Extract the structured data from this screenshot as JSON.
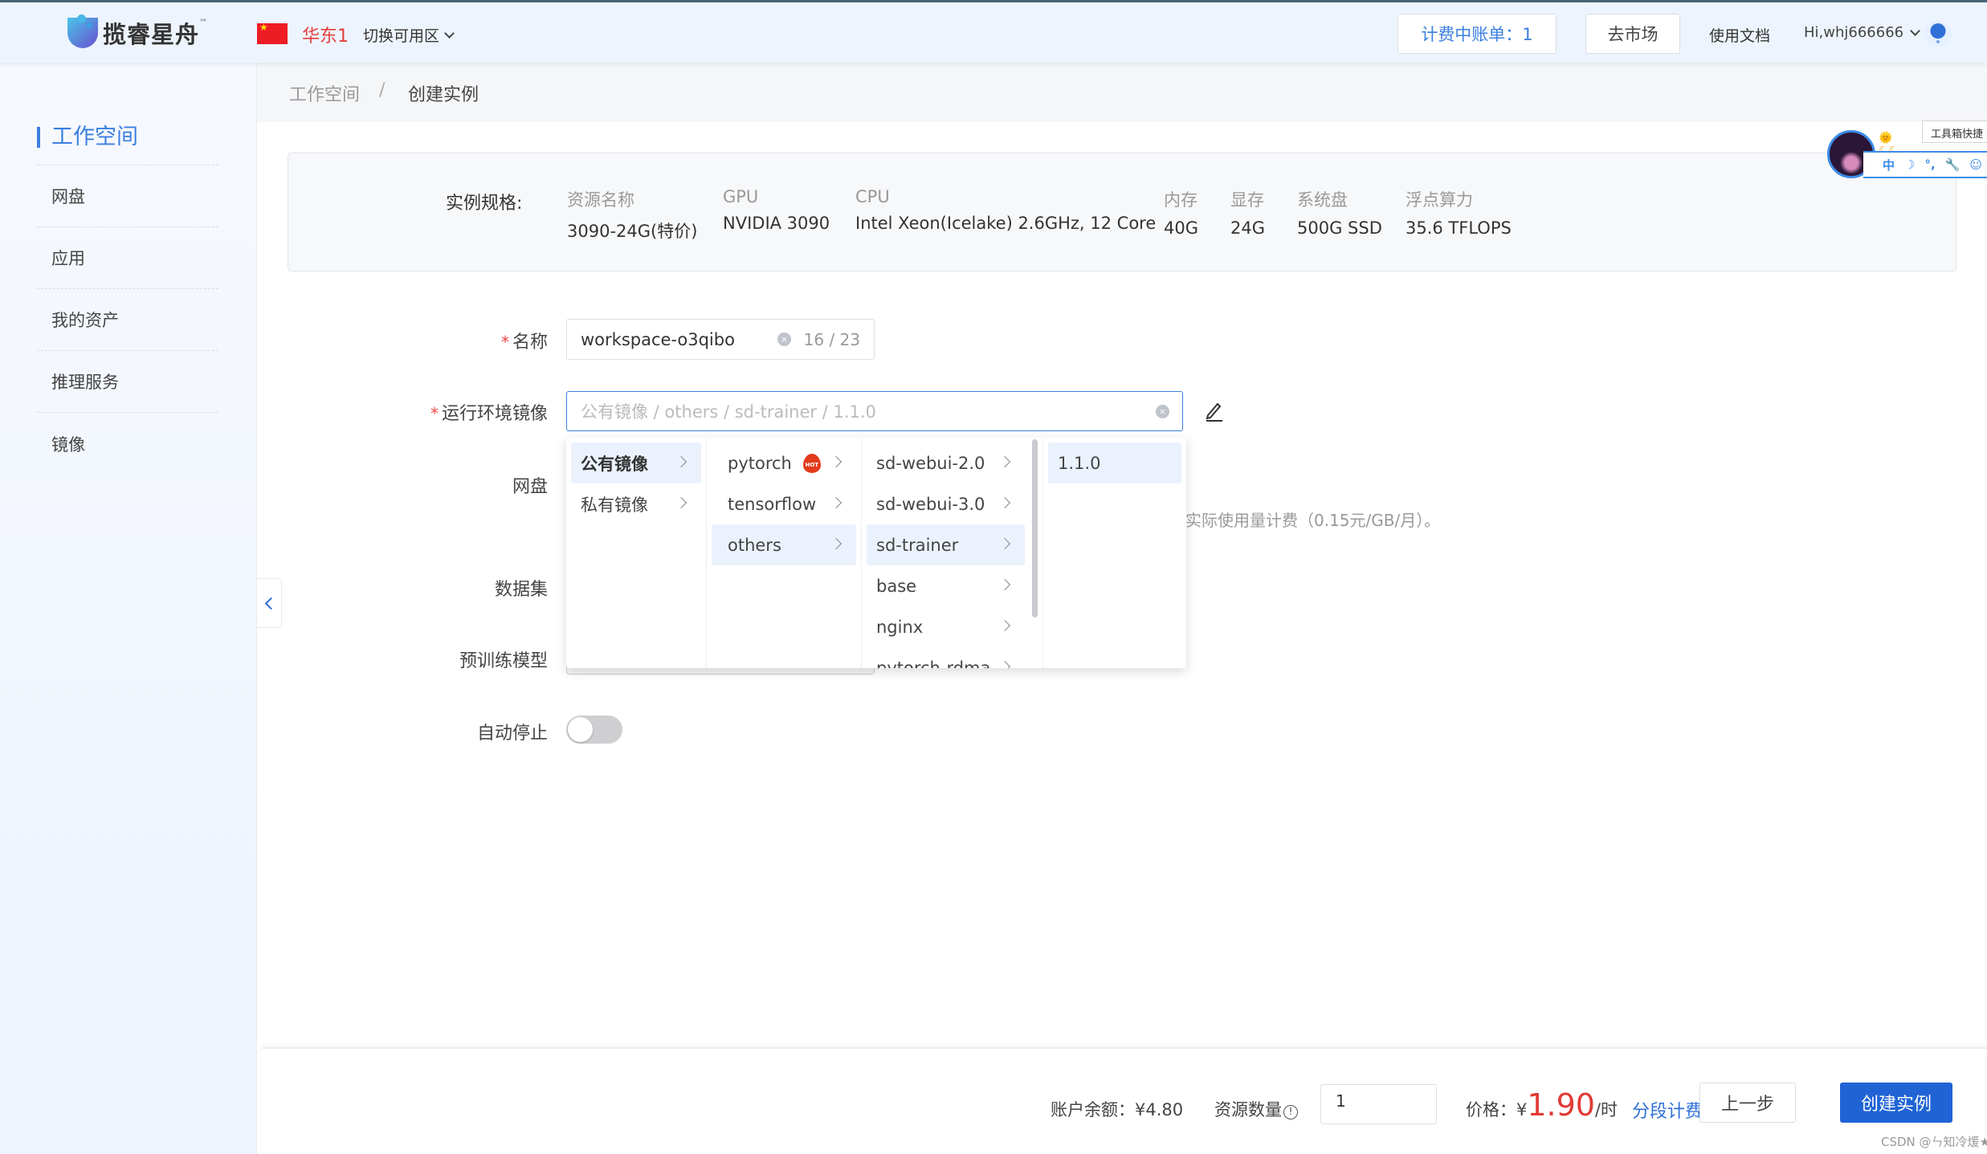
{
  "header": {
    "brand": "揽睿星舟",
    "brand_tm": "™",
    "region": "华东1",
    "switch_zone": "切换可用区",
    "billing_button": "计费中账单：1",
    "market_button": "去市场",
    "docs_link": "使用文档",
    "user": "Hi,whj666666"
  },
  "sidebar": {
    "items": [
      {
        "label": "工作空间",
        "active": true
      },
      {
        "label": "网盘"
      },
      {
        "label": "应用"
      },
      {
        "label": "我的资产"
      },
      {
        "label": "推理服务"
      },
      {
        "label": "镜像"
      }
    ]
  },
  "breadcrumb": {
    "items": [
      "工作空间",
      "创建实例"
    ],
    "separator": "/"
  },
  "spec": {
    "label": "实例规格:",
    "columns": [
      {
        "header": "资源名称",
        "value": "3090-24G(特价)"
      },
      {
        "header": "GPU",
        "value": "NVIDIA 3090"
      },
      {
        "header": "CPU",
        "value": "Intel Xeon(Icelake) 2.6GHz, 12 Core"
      },
      {
        "header": "内存",
        "value": "40G"
      },
      {
        "header": "显存",
        "value": "24G"
      },
      {
        "header": "系统盘",
        "value": "500G SSD"
      },
      {
        "header": "浮点算力",
        "value": "35.6 TFLOPS"
      }
    ]
  },
  "form": {
    "name_label": "名称",
    "name_value": "workspace-o3qibo",
    "name_count": "16 / 23",
    "image_label": "运行环境镜像",
    "image_placeholder": "公有镜像 / others / sd-trainer / 1.1.0",
    "disk_label": "网盘",
    "disk_hint": "实际使用量计费（0.15元/GB/月）。",
    "dataset_label": "数据集",
    "model_label": "预训练模型",
    "autostop_label": "自动停止",
    "autostop_on": false,
    "required_mark": "*"
  },
  "cascader": {
    "col1": [
      {
        "label": "公有镜像",
        "selected": true
      },
      {
        "label": "私有镜像"
      }
    ],
    "col2": [
      {
        "label": "pytorch",
        "badge": "HOT"
      },
      {
        "label": "tensorflow"
      },
      {
        "label": "others",
        "selected": true
      }
    ],
    "col3": [
      {
        "label": "sd-webui-2.0"
      },
      {
        "label": "sd-webui-3.0"
      },
      {
        "label": "sd-trainer",
        "selected": true
      },
      {
        "label": "base"
      },
      {
        "label": "nginx"
      },
      {
        "label": "pytorch-rdma"
      }
    ],
    "col4": [
      {
        "label": "1.1.0",
        "selected": true
      }
    ]
  },
  "widget": {
    "tooltip": "工具箱快捷",
    "icons": [
      "中",
      "☽",
      "°,",
      "🔧",
      "☺"
    ],
    "emoji": "🌞☾☾"
  },
  "footer": {
    "balance_label": "账户余额：",
    "balance_value": "¥4.80",
    "quantity_label": "资源数量",
    "quantity_value": "1",
    "price_label": "价格：",
    "price_currency": "¥",
    "price_value": "1.90",
    "price_unit": "/时",
    "segment_link": "分段计费",
    "prev_button": "上一步",
    "create_button": "创建实例",
    "watermark": "CSDN @ㄣ知冷煖★"
  },
  "colors": {
    "accent": "#3b7fe0",
    "primary_button": "#1f63d5",
    "price": "#e23a35",
    "region": "#e5403c"
  }
}
